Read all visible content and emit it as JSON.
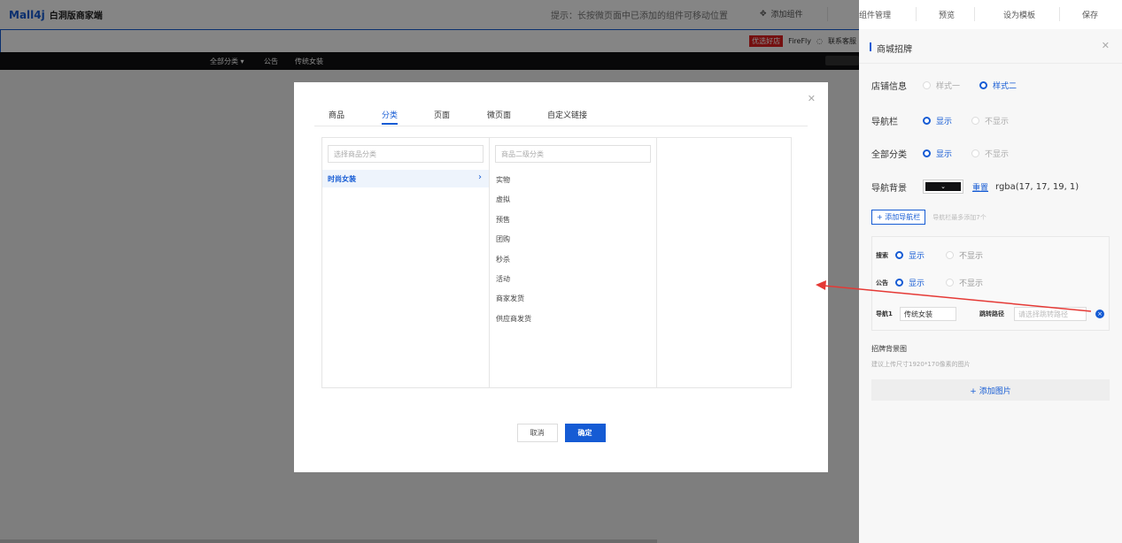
{
  "header": {
    "logo": "Mall4j",
    "subtitle": "白洞版商家端",
    "hint": "提示：长按微页面中已添加的组件可移动位置",
    "add_component": "添加组件",
    "menu": [
      "组件管理",
      "预览",
      "设为模板",
      "保存"
    ]
  },
  "canvas": {
    "shop_badge": "优选好店",
    "shop_name": "FireFly",
    "contact": "联系客服",
    "nav_items": [
      "全部分类 ▾",
      "公告",
      "传统女装"
    ]
  },
  "sidepanel": {
    "title": "商城招牌",
    "store_info": {
      "label": "店铺信息",
      "options": [
        "样式一",
        "样式二"
      ],
      "selected": "样式二"
    },
    "navbar": {
      "label": "导航栏",
      "options": [
        "显示",
        "不显示"
      ]
    },
    "all_category": {
      "label": "全部分类",
      "options": [
        "显示",
        "不显示"
      ]
    },
    "nav_bg": {
      "label": "导航背景",
      "reset": "重置",
      "value": "rgba(17, 17, 19, 1)",
      "color": "#111113"
    },
    "add_nav": {
      "button": "+ 添加导航栏",
      "hint": "导航栏最多添加7个"
    },
    "search_row": {
      "label": "搜索",
      "options": [
        "显示",
        "不显示"
      ]
    },
    "notice_row": {
      "label": "公告",
      "options": [
        "显示",
        "不显示"
      ]
    },
    "nav1": {
      "label": "导航1",
      "value": "传统女装",
      "link_label": "跳转路径",
      "link_placeholder": "请选择跳转路径"
    },
    "bg_image": {
      "title": "招牌背景图",
      "hint": "建议上传尺寸1920*170像素的图片",
      "add": "+ 添加图片"
    }
  },
  "modal": {
    "tabs": [
      "商品",
      "分类",
      "页面",
      "微页面",
      "自定义链接"
    ],
    "active_tab": "分类",
    "search1": "选择商品分类",
    "search2": "商品二级分类",
    "category": "时尚女装",
    "subcategories": [
      "实物",
      "虚拟",
      "预售",
      "团购",
      "秒杀",
      "活动",
      "商家发货",
      "供应商发货"
    ],
    "cancel": "取消",
    "confirm": "确定"
  },
  "colors": {
    "accent": "#155bd4",
    "nav_bg": "#111113",
    "badge": "#e02020",
    "arrow": "#e53935"
  }
}
